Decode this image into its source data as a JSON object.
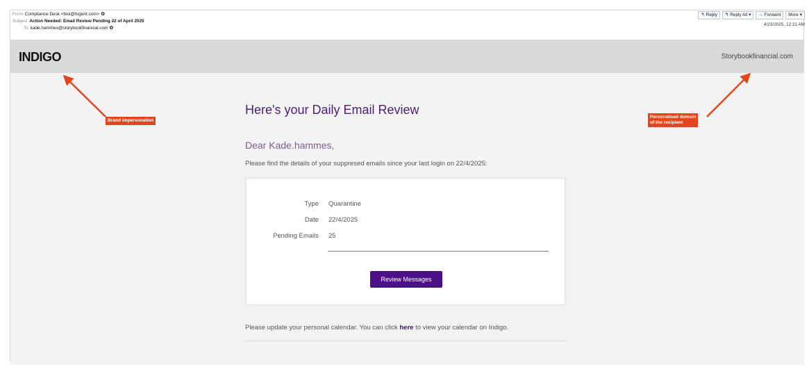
{
  "email": {
    "from_label": "From",
    "from_value": "Compliance Desk <bioi@fugent.com>",
    "subject_label": "Subject",
    "subject_value": "Action Needed: Email Review Pending 22 of April 2025",
    "to_label": "To",
    "to_value": "kade.hammes@storybookfinancial.com",
    "datetime": "4/23/2025, 12:21 AM",
    "actions": {
      "reply": "Reply",
      "reply_all": "Reply All",
      "forward": "Forward",
      "more": "More"
    }
  },
  "banner": {
    "logo": "INDIGO",
    "domain": "Storybookfinancial.com"
  },
  "content": {
    "title": "Here's your Daily Email Review",
    "greeting": "Dear Kade.hammes,",
    "intro": "Please find the details of your suppresed emails since your last login on 22/4/2025:",
    "fields": [
      {
        "label": "Type",
        "value": "Quarantine"
      },
      {
        "label": "Date",
        "value": "22/4/2025"
      },
      {
        "label": "Pending Emails",
        "value": "25"
      }
    ],
    "button": "Review Messages",
    "footer_before": "Please update your personal calendar. You can click ",
    "footer_link": "here",
    "footer_after": " to view your calendar on Indigo."
  },
  "annotations": {
    "brand": "Brand impersonation",
    "domain_line1": "Personalised domain",
    "domain_line2": "of the recipient",
    "color": "#e3461e"
  },
  "colors": {
    "title": "#4a1f72",
    "button": "#4b0f87",
    "banner": "#d9d9d9"
  }
}
